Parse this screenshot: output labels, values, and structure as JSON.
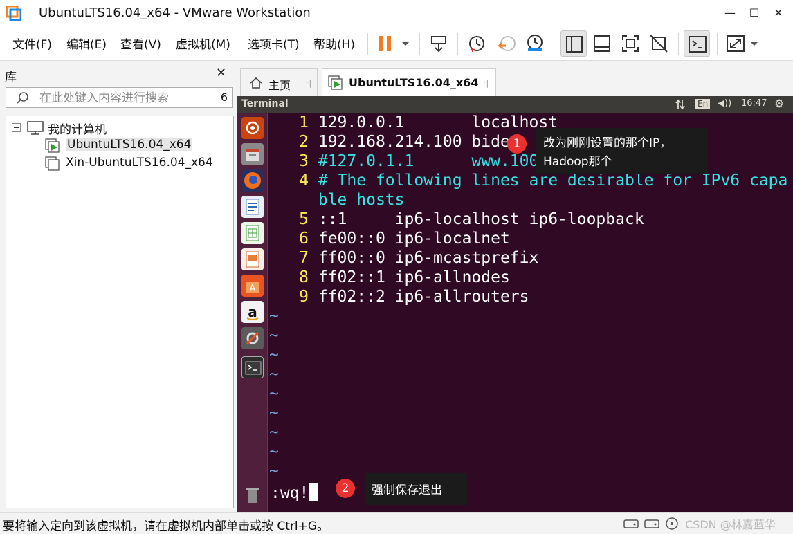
{
  "window": {
    "title": "UbuntuLTS16.04_x64 - VMware Workstation",
    "minimize": "—",
    "maximize": "☐",
    "close": "✕"
  },
  "menu": [
    "文件(F)",
    "编辑(E)",
    "查看(V)",
    "虚拟机(M)",
    "选项卡(T)",
    "帮助(H)"
  ],
  "library": {
    "title": "库",
    "close": "✕",
    "search_placeholder": "在此处键入内容进行搜索",
    "search_count": "6",
    "root_label": "我的计算机",
    "vms": [
      "UbuntuLTS16.04_x64",
      "Xin-UbuntuLTS16.04_x64"
    ]
  },
  "tabs": [
    {
      "label": "主页",
      "close": "r|"
    },
    {
      "label": "UbuntuLTS16.04_x64",
      "close": "r|"
    }
  ],
  "guest": {
    "app_title": "Terminal",
    "keyboard": "En",
    "volume": "◀))",
    "time": "16:47",
    "gear": "⚙"
  },
  "vim": {
    "lines": [
      {
        "n": "1",
        "text": "129.0.0.1       localhost",
        "style": "plain"
      },
      {
        "n": "2",
        "text": "192.168.214.100 bide",
        "style": "plain"
      },
      {
        "n": "3",
        "text": "#127.0.1.1      www.100ask.net",
        "style": "comment"
      },
      {
        "n": "4",
        "text": "# The following lines are desirable for IPv6 capa",
        "style": "comment"
      },
      {
        "n": "",
        "text": "ble hosts",
        "style": "comment"
      },
      {
        "n": "5",
        "text": "::1     ip6-localhost ip6-loopback",
        "style": "plain"
      },
      {
        "n": "6",
        "text": "fe00::0 ip6-localnet",
        "style": "plain"
      },
      {
        "n": "7",
        "text": "ff00::0 ip6-mcastprefix",
        "style": "plain"
      },
      {
        "n": "8",
        "text": "ff02::1 ip6-allnodes",
        "style": "plain"
      },
      {
        "n": "9",
        "text": "ff02::2 ip6-allrouters",
        "style": "plain"
      }
    ],
    "tilde": "~",
    "command": ":wq!"
  },
  "annotations": [
    {
      "badge": "1",
      "line1": "改为刚刚设置的那个IP，",
      "line2": "Hadoop那个"
    },
    {
      "badge": "2",
      "line1": "强制保存退出"
    }
  ],
  "status": {
    "text": "要将输入定向到该虚拟机，请在虚拟机内部单击或按 Ctrl+G。",
    "watermark": "CSDN @林嘉蓝华"
  },
  "colors": {
    "terminal_bg": "#300a24",
    "line_number": "#fce94f",
    "comment": "#34e2e2",
    "tilde": "#729fcf",
    "launcher_bg": "#4f1f3b",
    "pause_orange": "#f47b20",
    "badge_red": "#e8322f"
  }
}
